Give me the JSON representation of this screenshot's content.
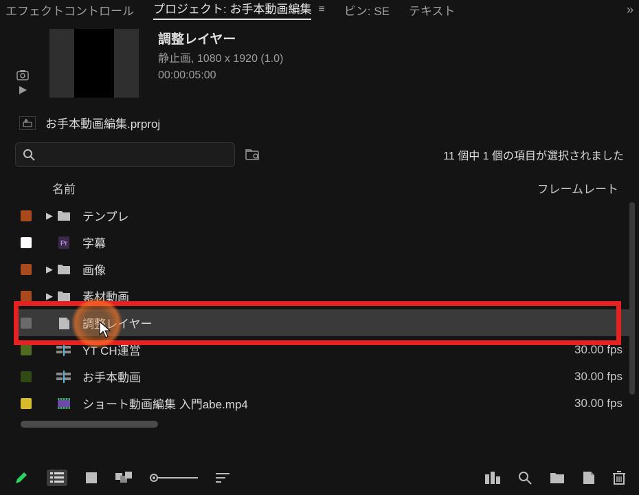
{
  "tabs": {
    "effect_controls": "エフェクトコントロール",
    "project": "プロジェクト: お手本動画編集",
    "bin_se": "ビン: SE",
    "text": "テキスト"
  },
  "preview": {
    "title": "調整レイヤー",
    "info_line": "静止画, 1080 x 1920 (1.0)",
    "duration": "00:00:05:00"
  },
  "project_file": "お手本動画編集.prproj",
  "search": {
    "placeholder": ""
  },
  "status": "11 個中 1 個の項目が選択されました",
  "columns": {
    "name": "名前",
    "framerate": "フレームレート"
  },
  "items": [
    {
      "color": "#a84a1e",
      "expand": true,
      "icon": "folder",
      "label": "テンプレ",
      "fps": ""
    },
    {
      "color": "#ffffff",
      "expand": false,
      "icon": "pr-doc",
      "label": "字幕",
      "fps": ""
    },
    {
      "color": "#a84a1e",
      "expand": true,
      "icon": "folder",
      "label": "画像",
      "fps": ""
    },
    {
      "color": "#a84a1e",
      "expand": true,
      "icon": "folder",
      "label": "素材動画",
      "fps": ""
    },
    {
      "color": "#6a6a6a",
      "expand": false,
      "icon": "adj-layer",
      "label": "調整レイヤー",
      "fps": "",
      "selected": true
    },
    {
      "color": "#4e6b1f",
      "expand": false,
      "icon": "sequence",
      "label": "YT CH運営",
      "fps": "30.00 fps"
    },
    {
      "color": "#2f4a12",
      "expand": false,
      "icon": "sequence",
      "label": "お手本動画",
      "fps": "30.00 fps"
    },
    {
      "color": "#d8bb2a",
      "expand": false,
      "icon": "video",
      "label": "ショート動画編集 入門abe.mp4",
      "fps": "30.00 fps"
    }
  ],
  "footer_tools": {
    "pencil": "pencil",
    "list": "list",
    "icon_view": "icon",
    "freeform": "freeform",
    "zoom": "zoom",
    "automate": "automate",
    "right": [
      "clip-view",
      "find",
      "new-bin",
      "new-item",
      "trash"
    ]
  }
}
